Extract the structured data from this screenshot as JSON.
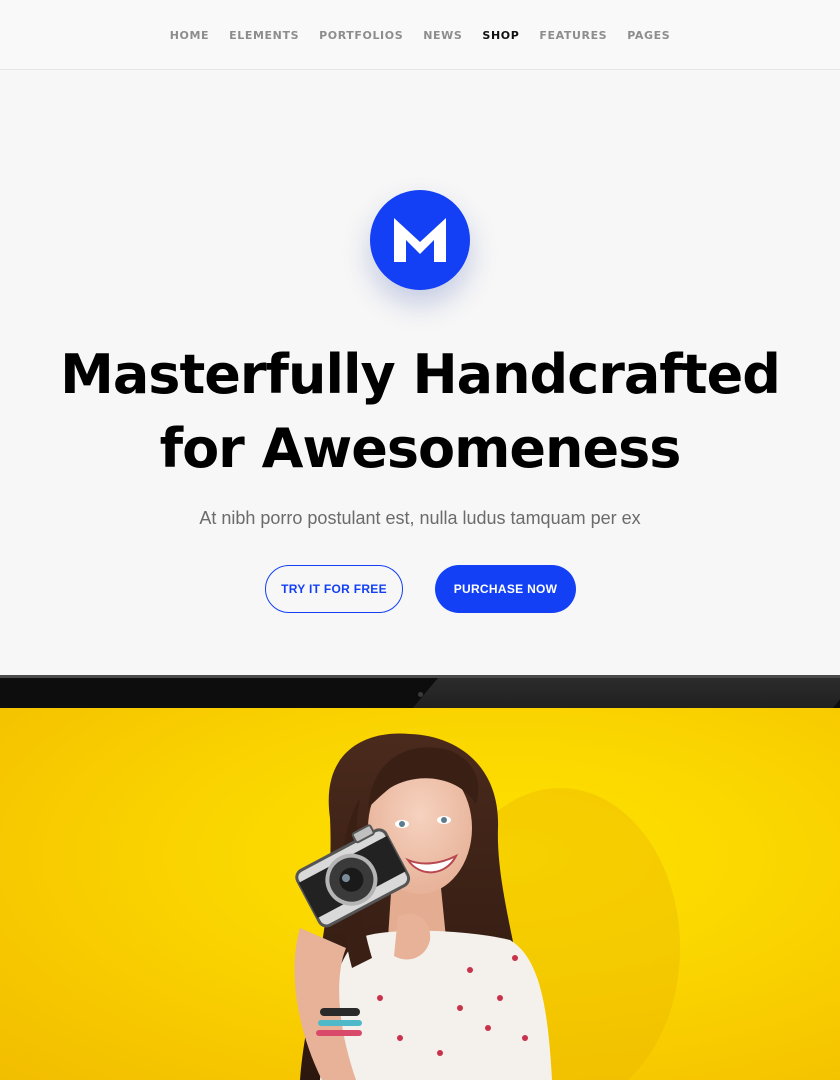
{
  "nav": {
    "items": [
      {
        "label": "HOME",
        "active": false
      },
      {
        "label": "ELEMENTS",
        "active": false
      },
      {
        "label": "PORTFOLIOS",
        "active": false
      },
      {
        "label": "NEWS",
        "active": false
      },
      {
        "label": "SHOP",
        "active": true
      },
      {
        "label": "FEATURES",
        "active": false
      },
      {
        "label": "PAGES",
        "active": false
      }
    ]
  },
  "hero": {
    "logo_icon": "m-logo-icon",
    "headline_line1": "Masterfully Handcrafted",
    "headline_line2": "for Awesomeness",
    "subline": "At nibh porro postulant est, nulla ludus tamquam per ex",
    "btn_try": "TRY IT FOR FREE",
    "btn_purchase": "PURCHASE NOW"
  },
  "photo": {
    "subject": "smiling woman holding a vintage camera"
  },
  "colors": {
    "accent": "#1340f5",
    "background": "#f7f7f7",
    "photo_bg": "#fbd800",
    "nav_text": "#8d8d8d",
    "nav_active": "#111111"
  }
}
